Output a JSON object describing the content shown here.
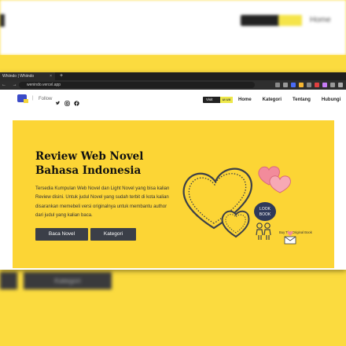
{
  "background": {
    "menu_label": "Home",
    "button_label": "Kategori"
  },
  "browser": {
    "tab_title": "Whiindo | Whiindo",
    "tab_close": "×",
    "new_tab": "+",
    "address": "wenindo.vercel.app",
    "nav_glyphs": "← → ↻"
  },
  "site": {
    "follow_label": "Follow",
    "separator": "|",
    "visit_label": "Visit",
    "visit_badge": "UI UX",
    "menu": [
      "Home",
      "Kategori",
      "Tentang",
      "Hubungi"
    ]
  },
  "hero": {
    "title_line1": "Review Web Novel",
    "title_line2": "Bahasa Indonesia",
    "description": "Tersedia Kumpulan Web Novel dan Light Novel yang bisa kalian Review disini. Untuk judul Novel yang sudah terbit di kota kalian disarankan memebeli versi originalnya untuk membantu author dari judul yang kalian baca.",
    "button_primary": "Baca Novel",
    "button_secondary": "Kategori",
    "badge_line1": "LOOK",
    "badge_line2": "BOOK",
    "buy_text": "Buy The Original Book"
  },
  "colors": {
    "brand_yellow": "#fcd535",
    "dark_button": "#3b3f48",
    "logo_blue": "#3b4bc8",
    "heart_pink": "#f28b9b"
  }
}
